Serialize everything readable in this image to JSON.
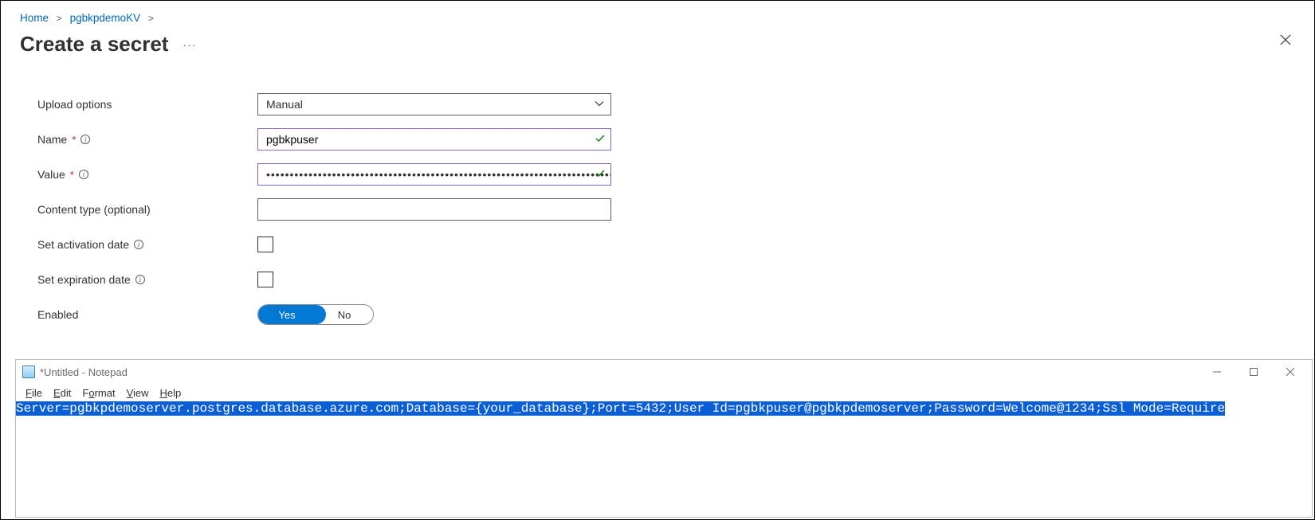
{
  "breadcrumb": {
    "home": "Home",
    "kv": "pgbkpdemoKV"
  },
  "pageTitle": "Create a secret",
  "form": {
    "uploadOptions": {
      "label": "Upload options",
      "value": "Manual"
    },
    "name": {
      "label": "Name",
      "value": "pgbkpuser"
    },
    "value": {
      "label": "Value",
      "masked": "••••••••••••••••••••••••••••••••••••••••••••••••••••••••••••••••••••••••••••••••••••••••••••••••"
    },
    "contentType": {
      "label": "Content type (optional)",
      "value": ""
    },
    "activationDate": {
      "label": "Set activation date"
    },
    "expirationDate": {
      "label": "Set expiration date"
    },
    "enabled": {
      "label": "Enabled",
      "yes": "Yes",
      "no": "No"
    }
  },
  "notepad": {
    "title": "*Untitled - Notepad",
    "menu": {
      "file": "File",
      "edit": "Edit",
      "format": "Format",
      "view": "View",
      "help": "Help"
    },
    "text": "Server=pgbkpdemoserver.postgres.database.azure.com;Database={your_database};Port=5432;User Id=pgbkpuser@pgbkpdemoserver;Password=Welcome@1234;Ssl Mode=Require"
  }
}
